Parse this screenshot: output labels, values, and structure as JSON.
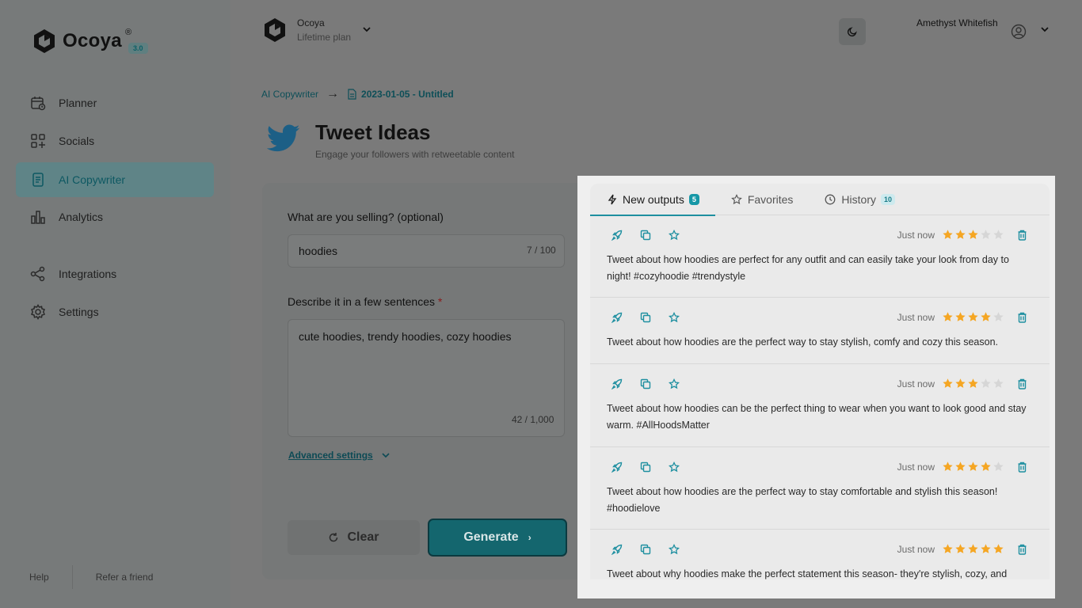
{
  "brand": {
    "name": "Ocoya",
    "registered": "®",
    "version": "3.0"
  },
  "sidebar": {
    "items": [
      {
        "label": "Planner",
        "icon": "calendar-icon"
      },
      {
        "label": "Socials",
        "icon": "grid-icon"
      },
      {
        "label": "AI Copywriter",
        "icon": "document-icon",
        "active": true
      },
      {
        "label": "Analytics",
        "icon": "bar-chart-icon"
      },
      {
        "label": "Integrations",
        "icon": "share-icon"
      },
      {
        "label": "Settings",
        "icon": "gear-icon"
      }
    ],
    "footer": {
      "help": "Help",
      "refer": "Refer a friend"
    }
  },
  "header": {
    "workspace_name": "Ocoya",
    "workspace_plan": "Lifetime plan",
    "user_name": "Amethyst Whitefish"
  },
  "breadcrumb": {
    "parent": "AI Copywriter",
    "arrow": "→",
    "current": "2023-01-05 - Untitled"
  },
  "page": {
    "title": "Tweet Ideas",
    "subtitle": "Engage your followers with retweetable content"
  },
  "form": {
    "selling_label": "What are you selling? (optional)",
    "selling_value": "hoodies",
    "selling_count": "7 / 100",
    "describe_label": "Describe it in a few sentences",
    "required_mark": "*",
    "describe_value": "cute hoodies, trendy hoodies, cozy hoodies",
    "describe_count": "42 / 1,000",
    "advanced_label": "Advanced settings",
    "clear_label": "Clear",
    "generate_label": "Generate"
  },
  "panel": {
    "tabs": [
      {
        "label": "New outputs",
        "badge": "5"
      },
      {
        "label": "Favorites"
      },
      {
        "label": "History",
        "badge": "10"
      }
    ],
    "outputs": [
      {
        "time": "Just now",
        "rating": 3,
        "text": "Tweet about how hoodies are perfect for any outfit and can easily take your look from day to night! #cozyhoodie #trendystyle"
      },
      {
        "time": "Just now",
        "rating": 4,
        "text": "Tweet about how hoodies are the perfect way to stay stylish, comfy and cozy this season."
      },
      {
        "time": "Just now",
        "rating": 3,
        "text": "Tweet about how hoodies can be the perfect thing to wear when you want to look good and stay warm. #AllHoodsMatter"
      },
      {
        "time": "Just now",
        "rating": 4,
        "text": "Tweet about how hoodies are the perfect way to stay comfortable and stylish this season! #hoodielove"
      },
      {
        "time": "Just now",
        "rating": 5,
        "text": "Tweet about why hoodies make the perfect statement this season- they're stylish, cozy, and"
      }
    ]
  },
  "colors": {
    "accent": "#1e8fa0",
    "star": "#f5a623",
    "star_empty": "#d6d6d6",
    "overlay": "#777a7a"
  }
}
